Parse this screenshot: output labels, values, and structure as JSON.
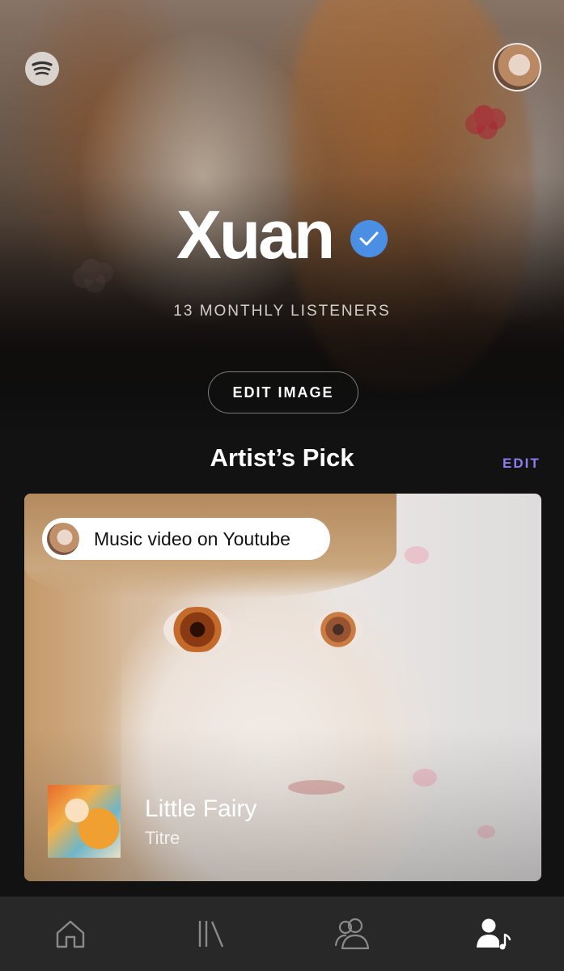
{
  "header": {
    "logo_icon": "spotify-logo-icon",
    "profile_avatar_icon": "profile-avatar-icon"
  },
  "artist": {
    "name": "Xuan",
    "verified_icon": "verified-check-icon",
    "monthly_listeners": "13 MONTHLY LISTENERS",
    "edit_image_label": "EDIT IMAGE"
  },
  "artists_pick": {
    "title": "Artist’s Pick",
    "edit_label": "EDIT",
    "badge_text": "Music video on Youtube",
    "track_title": "Little Fairy",
    "track_type": "Titre"
  },
  "tabbar": {
    "tabs": [
      {
        "icon": "home-icon",
        "active": false
      },
      {
        "icon": "library-icon",
        "active": false
      },
      {
        "icon": "audience-icon",
        "active": false
      },
      {
        "icon": "artist-profile-icon",
        "active": true
      }
    ]
  },
  "colors": {
    "background": "#121212",
    "tabbar": "#282828",
    "accent_edit": "#8c7cf0",
    "verified": "#4a8fe3",
    "inactive_icon": "#8a8a8a"
  }
}
